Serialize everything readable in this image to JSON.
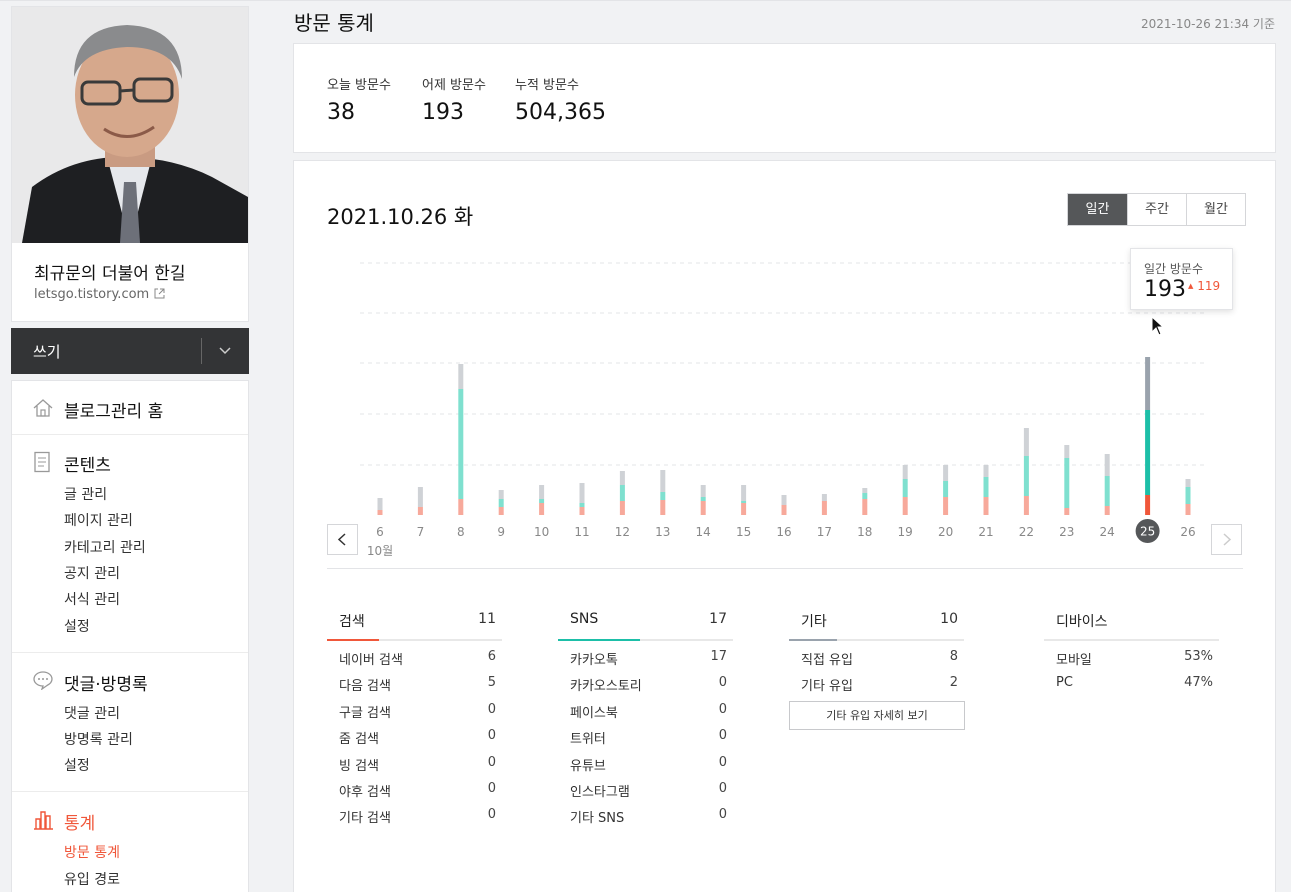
{
  "blog": {
    "title": "최규문의 더불어 한길",
    "url": "letsgo.tistory.com"
  },
  "write": {
    "label": "쓰기"
  },
  "menu": {
    "home": "블로그관리 홈",
    "contents": {
      "label": "콘텐츠",
      "items": [
        "글 관리",
        "페이지 관리",
        "카테고리 관리",
        "공지 관리",
        "서식 관리",
        "설정"
      ]
    },
    "comments": {
      "label": "댓글·방명록",
      "items": [
        "댓글 관리",
        "방명록 관리",
        "설정"
      ]
    },
    "stats": {
      "label": "통계",
      "items": [
        "방문 통계",
        "유입 경로"
      ]
    }
  },
  "page": {
    "title": "방문 통계",
    "timestamp": "2021-10-26 21:34 기준"
  },
  "summary": [
    {
      "label": "오늘 방문수",
      "value": "38"
    },
    {
      "label": "어제 방문수",
      "value": "193"
    },
    {
      "label": "누적 방문수",
      "value": "504,365"
    }
  ],
  "chart_title": "2021.10.26 화",
  "period_tabs": [
    "일간",
    "주간",
    "월간"
  ],
  "tooltip": {
    "label": "일간 방문수",
    "value": "193",
    "diff": "119"
  },
  "month_label": "10월",
  "colors": {
    "accent": "#f0573a",
    "search": "#f0573a",
    "sns": "#1dbfa8",
    "other": "#9aa3ad"
  },
  "chart_data": {
    "type": "bar",
    "stacked": true,
    "categories": [
      "6",
      "7",
      "8",
      "9",
      "10",
      "11",
      "12",
      "13",
      "14",
      "15",
      "16",
      "17",
      "18",
      "19",
      "20",
      "21",
      "22",
      "23",
      "24",
      "25",
      "26"
    ],
    "highlight": "25",
    "series": [
      {
        "name": "검색",
        "values": [
          5,
          8,
          16,
          8,
          12,
          8,
          14,
          15,
          14,
          12,
          10,
          14,
          16,
          18,
          18,
          18,
          19,
          7,
          9,
          20,
          11
        ]
      },
      {
        "name": "SNS",
        "values": [
          0,
          0,
          110,
          8,
          4,
          4,
          16,
          8,
          4,
          2,
          0,
          0,
          6,
          18,
          16,
          20,
          40,
          50,
          30,
          85,
          17
        ]
      },
      {
        "name": "기타",
        "values": [
          12,
          20,
          25,
          9,
          14,
          20,
          14,
          22,
          12,
          16,
          10,
          7,
          5,
          14,
          16,
          12,
          28,
          13,
          22,
          53,
          8
        ]
      }
    ]
  },
  "breakdown": {
    "search": {
      "label": "검색",
      "count": "11",
      "rows": [
        [
          "네이버 검색",
          "6"
        ],
        [
          "다음 검색",
          "5"
        ],
        [
          "구글 검색",
          "0"
        ],
        [
          "줌 검색",
          "0"
        ],
        [
          "빙 검색",
          "0"
        ],
        [
          "야후 검색",
          "0"
        ],
        [
          "기타 검색",
          "0"
        ]
      ]
    },
    "sns": {
      "label": "SNS",
      "count": "17",
      "rows": [
        [
          "카카오톡",
          "17"
        ],
        [
          "카카오스토리",
          "0"
        ],
        [
          "페이스북",
          "0"
        ],
        [
          "트위터",
          "0"
        ],
        [
          "유튜브",
          "0"
        ],
        [
          "인스타그램",
          "0"
        ],
        [
          "기타 SNS",
          "0"
        ]
      ]
    },
    "other": {
      "label": "기타",
      "count": "10",
      "rows": [
        [
          "직접 유입",
          "8"
        ],
        [
          "기타 유입",
          "2"
        ]
      ],
      "button": "기타 유입 자세히 보기"
    },
    "device": {
      "label": "디바이스",
      "rows": [
        [
          "모바일",
          "53%"
        ],
        [
          "PC",
          "47%"
        ]
      ]
    }
  }
}
